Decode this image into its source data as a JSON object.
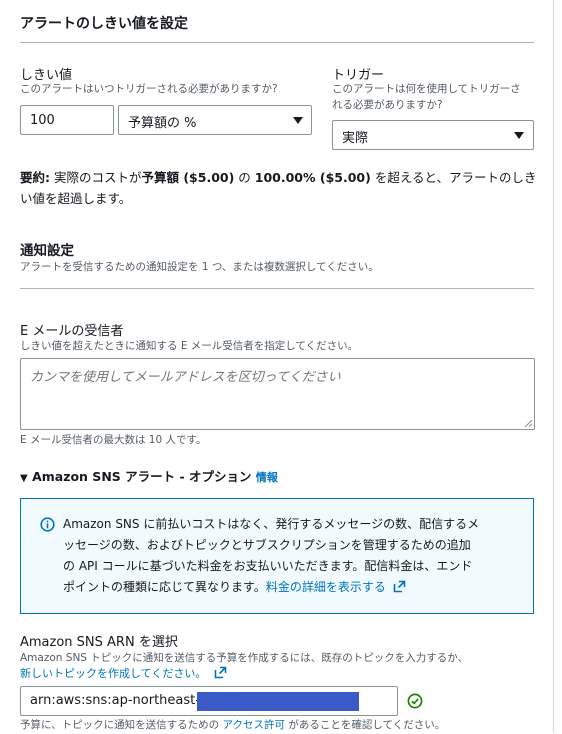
{
  "section_title": "アラートのしきい値を設定",
  "threshold": {
    "label": "しきい値",
    "description": "このアラートはいつトリガーされる必要がありますか?",
    "value": "100",
    "unit_select": "予算額の %"
  },
  "trigger": {
    "label": "トリガー",
    "description_line1": "このアラートは何を使用してトリガーさ",
    "description_line2": "れる必要がありますか?",
    "select_value": "実際"
  },
  "summary": {
    "prefix": "要約:",
    "part1": " 実際のコストが",
    "bold1": "予算額 ($5.00)",
    "part2": " の ",
    "bold2": "100.00% ($5.00)",
    "part3": " を超えると、アラートのしき",
    "line2": "い値を超過します。"
  },
  "notification": {
    "title": "通知設定",
    "description": "アラートを受信するための通知設定を 1 つ、または複数選択してください。"
  },
  "email": {
    "label": "E メールの受信者",
    "description": "しきい値を超えたときに通知する E メール受信者を指定してください。",
    "placeholder": "カンマを使用してメールアドレスを区切ってください",
    "hint": "E メール受信者の最大数は 10 人です。"
  },
  "sns": {
    "expander_label": "Amazon SNS アラート - オプション",
    "info_link": "情報",
    "info_box": {
      "line1": "Amazon SNS に前払いコストはなく、発行するメッセージの数、配信するメ",
      "line2": "ッセージの数、およびトピックとサブスクリプションを管理するための追加",
      "line3": "の API コールに基づいた料金をお支払いいただきます。配信料金は、エンド",
      "line4_text": "ポイントの種類に応じて異なります。",
      "line4_link": "料金の詳細を表示する"
    },
    "arn_label": "Amazon SNS ARN を選択",
    "arn_description": "Amazon SNS トピックに通知を送信する予算を作成するには、既存のトピックを入力するか、",
    "arn_new_topic_link": "新しいトピックを作成してください。",
    "arn_value": "arn:aws:sns:ap-northeast-1:",
    "footer_text1": "予算に、トピックに通知を送信するための ",
    "footer_link": "アクセス許可",
    "footer_text2": " があることを確認してください。"
  },
  "colors": {
    "link": "#0073bb",
    "info_border": "#0073bb",
    "info_bg": "#f1faff",
    "redaction": "#3a5bc7",
    "success": "#1d8102"
  },
  "icons": [
    "caret-down-icon",
    "expand-triangle-icon",
    "info-circle-icon",
    "external-link-icon",
    "check-circle-icon",
    "resize-grip-icon"
  ]
}
